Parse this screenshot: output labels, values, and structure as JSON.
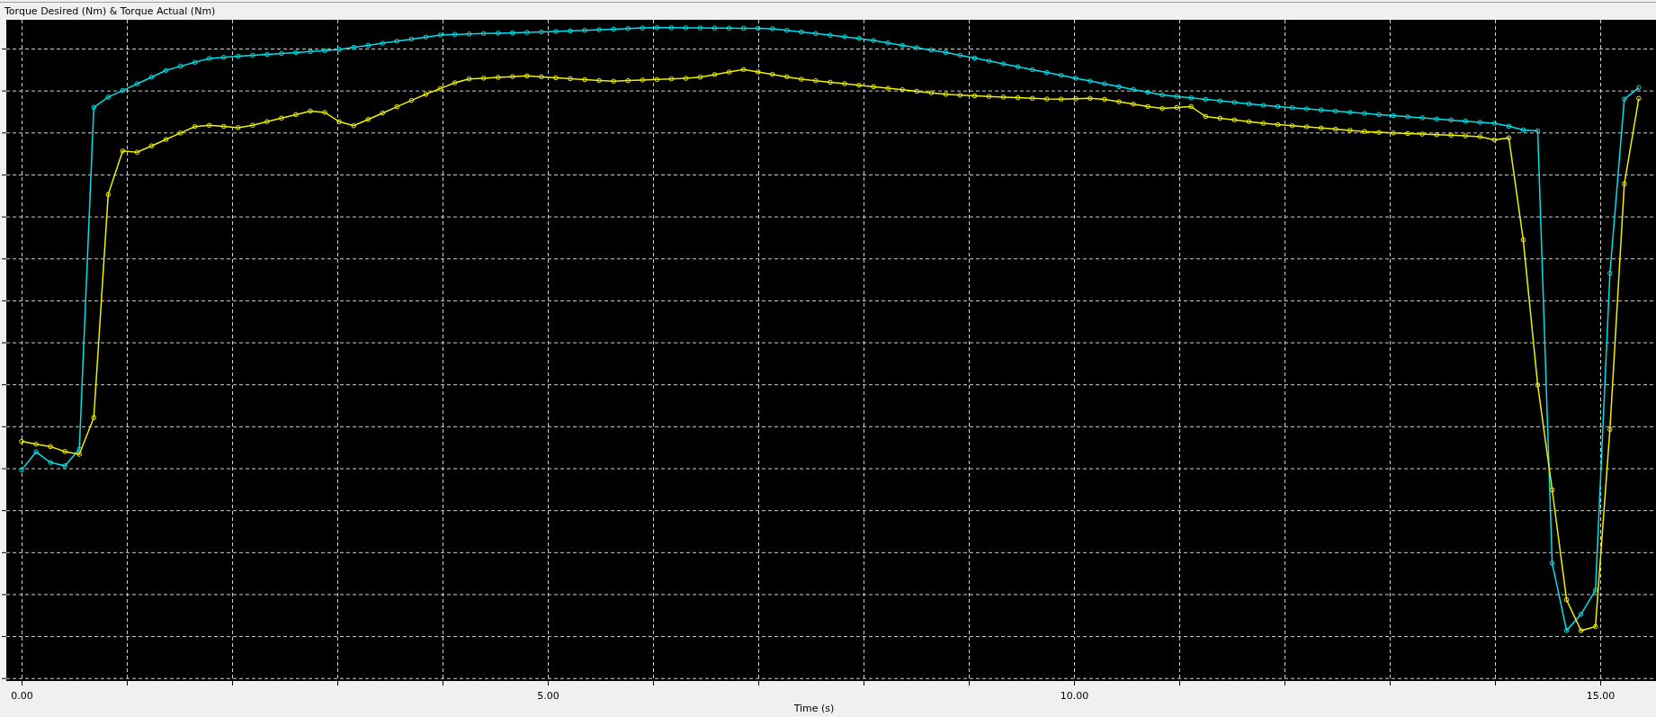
{
  "panel": {
    "title": "Torque Desired (Nm) & Torque Actual (Nm)"
  },
  "plot": {
    "xlabel": "Time (s)",
    "x_tick_labels": [
      "0.00",
      "5.00",
      "10.00",
      "15.00"
    ],
    "series": [
      {
        "color": "#00e0e8"
      },
      {
        "color": "#f0f000"
      }
    ]
  }
}
